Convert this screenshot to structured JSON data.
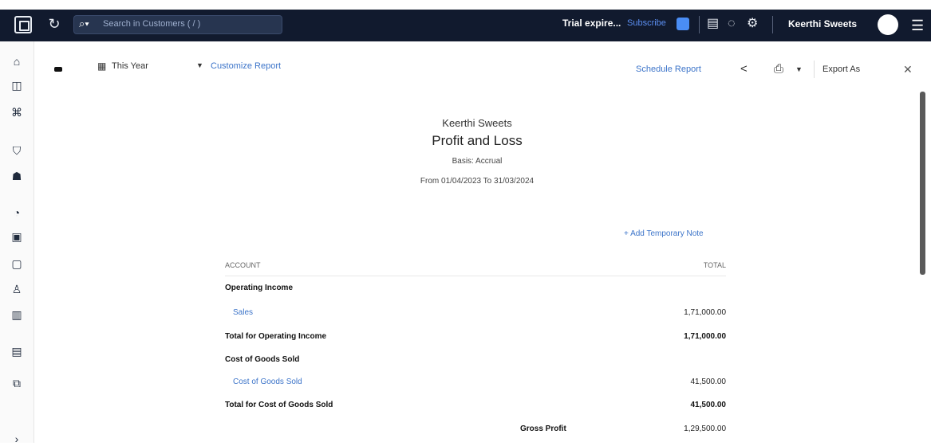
{
  "topbar": {
    "search_placeholder": "Search in Customers ( / )",
    "trial_text": "Trial expire...",
    "subscribe_label": "Subscribe",
    "org_name": "Keerthi Sweets"
  },
  "toolbar": {
    "period_label": "This Year",
    "customize_label": "Customize Report",
    "schedule_label": "Schedule Report",
    "export_label": "Export As"
  },
  "report": {
    "company": "Keerthi Sweets",
    "title": "Profit and Loss",
    "basis": "Basis: Accrual",
    "date_range": "From 01/04/2023 To 31/03/2024",
    "add_note_label": "+ Add Temporary Note",
    "header_account": "ACCOUNT",
    "header_total": "TOTAL",
    "rows": [
      {
        "label": "Operating Income",
        "value": "",
        "style": "bold"
      },
      {
        "label": "Sales",
        "value": "1,71,000.00",
        "style": "link"
      },
      {
        "label": "Total for Operating Income",
        "value": "1,71,000.00",
        "style": "bold"
      },
      {
        "label": "Cost of Goods Sold",
        "value": "",
        "style": "bold"
      },
      {
        "label": "Cost of Goods Sold",
        "value": "41,500.00",
        "style": "link"
      },
      {
        "label": "Total for Cost of Goods Sold",
        "value": "41,500.00",
        "style": "bold"
      },
      {
        "label": "Gross Profit",
        "value": "1,29,500.00",
        "style": "gross"
      }
    ]
  },
  "colors": {
    "topbar": "#111a2e",
    "link": "#3c74c9",
    "accent": "#4a8df5"
  }
}
